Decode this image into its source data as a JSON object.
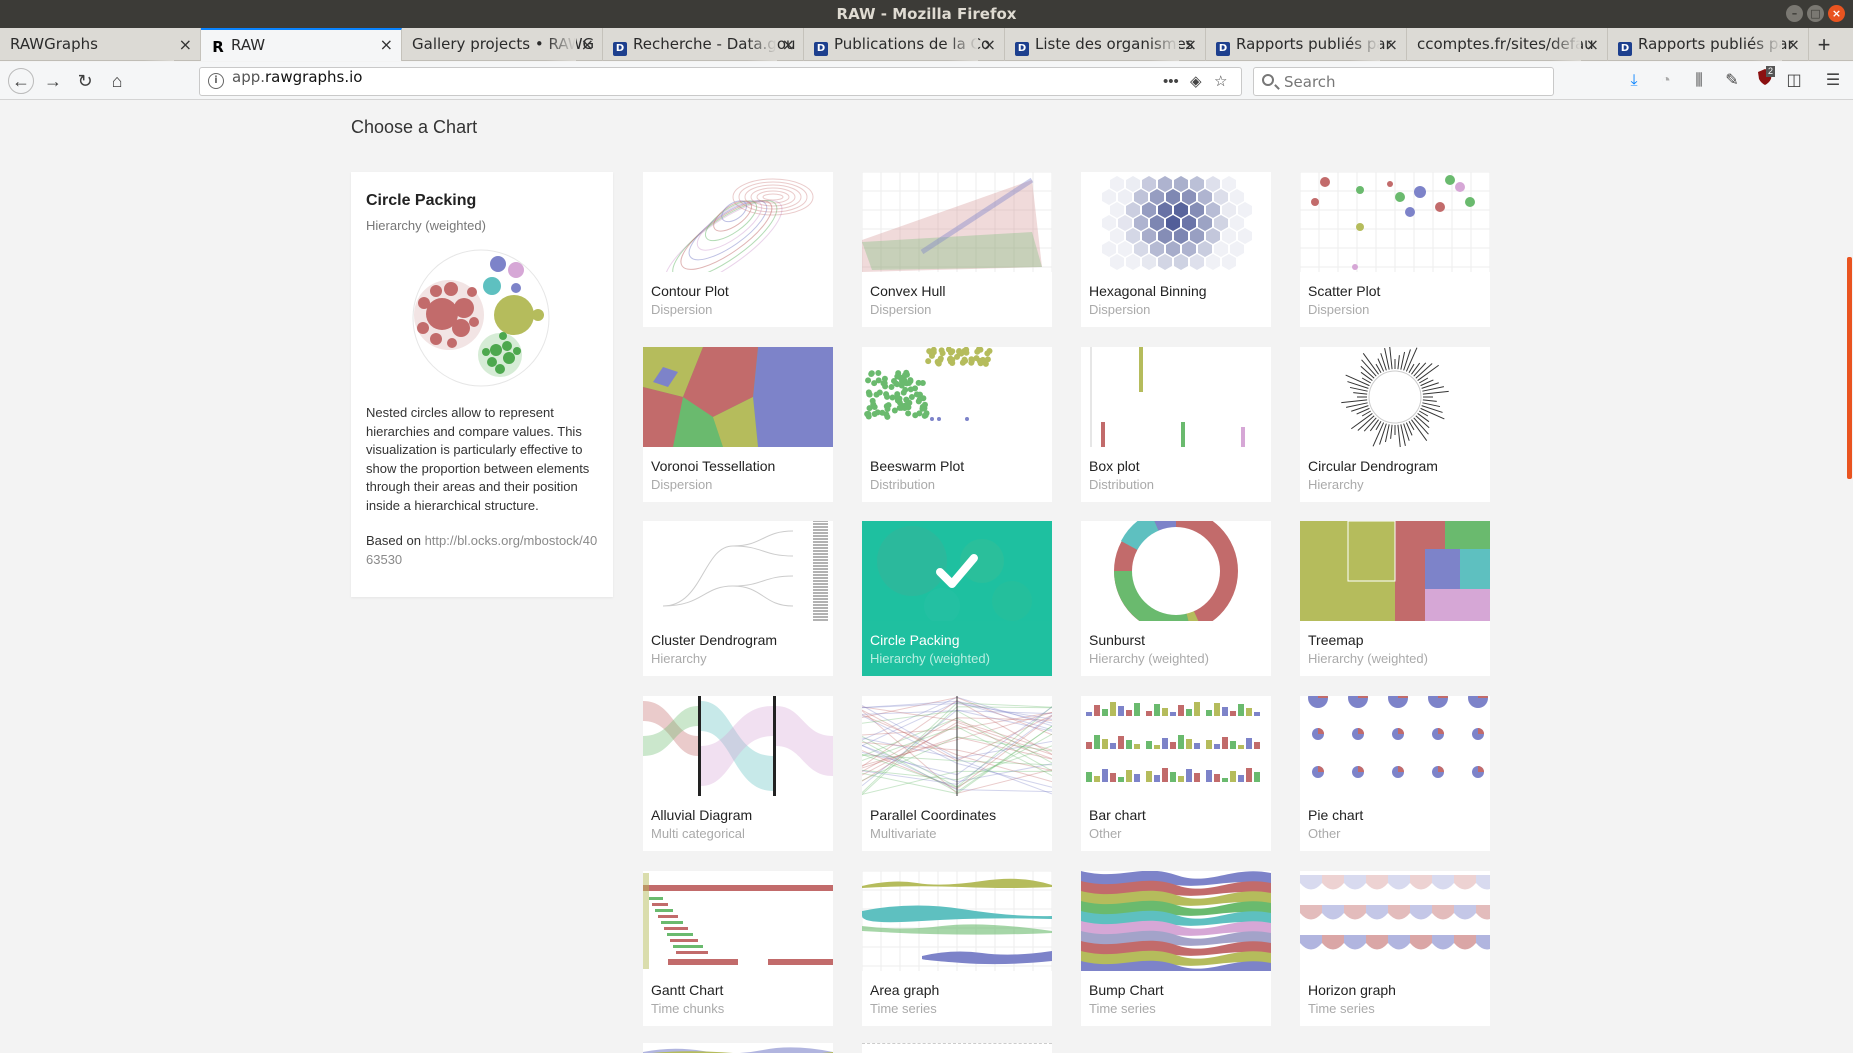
{
  "window": {
    "title": "RAW - Mozilla Firefox"
  },
  "tabs": [
    {
      "label": "RAWGraphs",
      "favicon": ""
    },
    {
      "label": "RAW",
      "favicon": "R",
      "active": true
    },
    {
      "label": "Gallery projects • RAWG",
      "favicon": ""
    },
    {
      "label": "Recherche - Data.gou",
      "favicon": "D"
    },
    {
      "label": "Publications de la Co",
      "favicon": "D"
    },
    {
      "label": "Liste des organismes",
      "favicon": "D"
    },
    {
      "label": "Rapports publiés par",
      "favicon": "D"
    },
    {
      "label": "ccomptes.fr/sites/defau",
      "favicon": ""
    },
    {
      "label": "Rapports publiés par",
      "favicon": "D"
    }
  ],
  "navbar": {
    "url_host": "app.",
    "url_domain": "rawgraphs.io",
    "search_placeholder": "Search",
    "ublock_badge": "2"
  },
  "page": {
    "heading": "Choose a Chart",
    "detail": {
      "title": "Circle Packing",
      "category": "Hierarchy (weighted)",
      "description": "Nested circles allow to represent hierarchies and compare values. This visualization is particularly effective to show the proportion between elements through their areas and their position inside a hierarchical structure.",
      "based_on_label": "Based on",
      "based_on_link": "http://bl.ocks.org/mbostock/4063530"
    },
    "charts": [
      {
        "title": "Contour Plot",
        "category": "Dispersion",
        "thumb": "contour"
      },
      {
        "title": "Convex Hull",
        "category": "Dispersion",
        "thumb": "hull"
      },
      {
        "title": "Hexagonal Binning",
        "category": "Dispersion",
        "thumb": "hex"
      },
      {
        "title": "Scatter Plot",
        "category": "Dispersion",
        "thumb": "scatter"
      },
      {
        "title": "Voronoi Tessellation",
        "category": "Dispersion",
        "thumb": "voronoi"
      },
      {
        "title": "Beeswarm Plot",
        "category": "Distribution",
        "thumb": "beeswarm"
      },
      {
        "title": "Box plot",
        "category": "Distribution",
        "thumb": "boxplot"
      },
      {
        "title": "Circular Dendrogram",
        "category": "Hierarchy",
        "thumb": "circdendro"
      },
      {
        "title": "Cluster Dendrogram",
        "category": "Hierarchy",
        "thumb": "cluster"
      },
      {
        "title": "Circle Packing",
        "category": "Hierarchy (weighted)",
        "thumb": "packing",
        "selected": true
      },
      {
        "title": "Sunburst",
        "category": "Hierarchy (weighted)",
        "thumb": "sunburst"
      },
      {
        "title": "Treemap",
        "category": "Hierarchy (weighted)",
        "thumb": "treemap"
      },
      {
        "title": "Alluvial Diagram",
        "category": "Multi categorical",
        "thumb": "alluvial"
      },
      {
        "title": "Parallel Coordinates",
        "category": "Multivariate",
        "thumb": "parallel"
      },
      {
        "title": "Bar chart",
        "category": "Other",
        "thumb": "bar"
      },
      {
        "title": "Pie chart",
        "category": "Other",
        "thumb": "pie"
      },
      {
        "title": "Gantt Chart",
        "category": "Time chunks",
        "thumb": "gantt"
      },
      {
        "title": "Area graph",
        "category": "Time series",
        "thumb": "area"
      },
      {
        "title": "Bump Chart",
        "category": "Time series",
        "thumb": "bump"
      },
      {
        "title": "Horizon graph",
        "category": "Time series",
        "thumb": "horizon"
      }
    ]
  },
  "colors": {
    "accent": "#1fc0a0",
    "browser_accent": "#e95420",
    "palette": [
      "#c26b6b",
      "#b5bc5c",
      "#6aba6e",
      "#7d83c9",
      "#5ec0c0",
      "#d6a7d6",
      "#a3a3c9"
    ]
  }
}
